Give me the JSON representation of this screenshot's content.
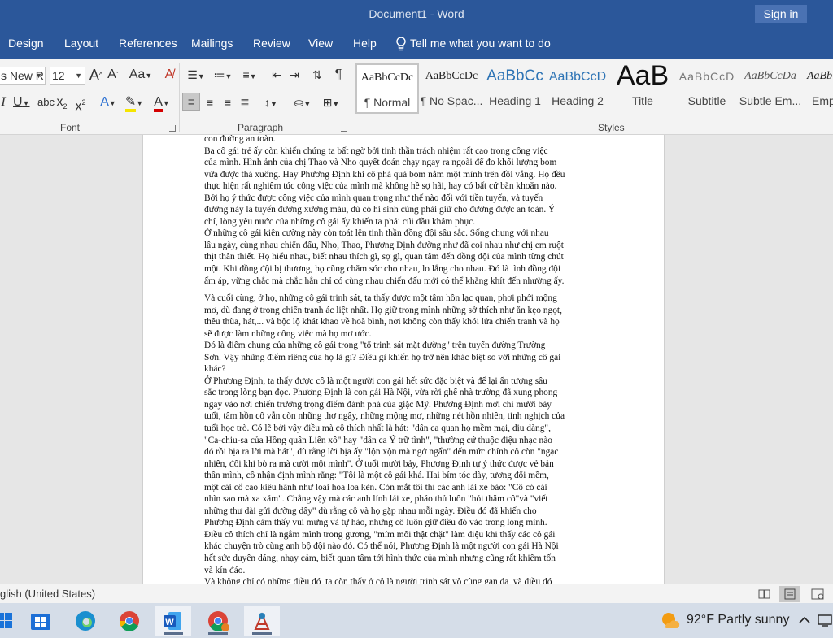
{
  "titlebar": {
    "title": "Document1  -  Word",
    "signin": "Sign in"
  },
  "tabs": [
    "Design",
    "Layout",
    "References",
    "Mailings",
    "Review",
    "View",
    "Help"
  ],
  "tellme": "Tell me what you want to do",
  "font": {
    "name": "s New R",
    "size": "12",
    "group_label": "Font"
  },
  "paragraph": {
    "group_label": "Paragraph"
  },
  "styles": {
    "group_label": "Styles",
    "items": [
      {
        "preview": "AaBbCcDc",
        "name": "¶ Normal"
      },
      {
        "preview": "AaBbCcDc",
        "name": "¶ No Spac..."
      },
      {
        "preview": "AaBbCc",
        "name": "Heading 1"
      },
      {
        "preview": "AaBbCcD",
        "name": "Heading 2"
      },
      {
        "preview": "AaB",
        "name": "Title"
      },
      {
        "preview": "AaBbCcD",
        "name": "Subtitle"
      },
      {
        "preview": "AaBbCcDa",
        "name": "Subtle Em..."
      },
      {
        "preview": "AaBb",
        "name": "Emp"
      }
    ]
  },
  "colors": {
    "accent": "#2b579a",
    "highlight": "#f5e500",
    "font_color": "#d40000"
  },
  "document": {
    "page1_lines": [
      "con đường an toàn.",
      "   Ba cô gái trẻ ấy còn khiến chúng ta bất ngờ bởi tinh thần trách nhiệm rất cao trong công việc",
      "của mình. Hình ảnh của chị Thao và Nho quyết đoán chạy ngay ra ngoài để đo khối lượng bom",
      "vừa được thả xuống. Hay Phương Định khi cô phá quả bom nằm một mình trên đồi vắng. Họ đều",
      "thực hiện rất nghiêm túc công việc của mình mà không hề sợ hãi, hay có bất cứ băn khoăn nào.",
      "Bởi họ ý thức được công việc của mình quan trọng như thế nào đối với tiền tuyến, và tuyến",
      "đường này là tuyến đường xương máu, dù có hi sinh cũng phải giữ cho đường được an toàn. Ý",
      "chí, lòng yêu nước của những cô gái ấy khiến ta phải cúi đầu khâm phục.",
      "   Ở những cô gái kiên cường này còn toát lên tinh thần đồng đội sâu sắc. Sống chung với nhau",
      "lâu ngày, cùng nhau chiến đấu, Nho, Thao, Phương Định đường như đã coi nhau như chị em ruột",
      "thịt thân thiết. Họ hiểu nhau, biết nhau thích gì, sợ gì, quan tâm đến đồng đội của mình từng chút",
      "một. Khi đồng đội bị thương, họ cũng chăm sóc cho nhau, lo lắng cho nhau. Đó là tình đồng đội",
      "ấm áp, vững chắc mà chắc hẳn chỉ có cùng nhau chiến đấu mới có thể khăng khít đến nhường ấy."
    ],
    "page2_lines": [
      "   Và cuối cùng, ở họ, những cô gái trinh sát, ta thấy được một tâm hồn lạc quan, phơi phới mộng",
      "mơ, dù đang ở trong chiến tranh ác liệt nhất. Họ giữ trong mình những sở thích như ăn kẹo ngọt,",
      "thêu thùa, hát,... và bộc lộ khát khao về hoà bình, nơi không còn thấy khói lửa chiến tranh và họ",
      "sẽ được làm những công việc mà họ mơ ước.",
      "   Đó là điểm chung của những cô gái trong \"tổ trinh sát mặt đường\" trên tuyến đường Trường",
      "Sơn. Vậy những điểm riêng của họ là gì? Điều gì khiến họ trở nên khác biệt so với những cô gái",
      "khác?",
      "   Ở Phương Định, ta thấy được cô là một người con gái hết sức đặc biệt và để lại ấn tượng sâu",
      "sắc trong lòng bạn đọc. Phương Định là con gái Hà Nội, vừa rời ghế nhà trường đã xung phong",
      "ngay vào nơi chiến trường trọng điểm đánh phá của giặc Mỹ. Phương Định mới chỉ mười bảy",
      "tuổi, tâm hồn cô vẫn còn những thơ ngây, những mộng mơ, những nét hồn nhiên, tinh nghịch của",
      "tuổi học trò. Có lẽ bởi vậy điều mà cô thích nhất là hát: \"dân ca quan họ mềm mại, dịu dàng\",",
      "\"Ca-chiu-sa của Hồng quân Liên xô\" hay \"dân ca Ý trữ tình\", \"thường cứ thuộc điệu nhạc nào",
      "đó rồi bịa ra lời mà hát\", dù rằng lời bịa ấy \"lộn xộn mà ngớ ngẩn\" đến mức chính cô còn \"ngạc",
      "nhiên, đôi khi bò ra mà cười một mình\". Ở tuổi mười bảy, Phương Định tự ý thức được vẻ bản",
      "thân mình, cô nhận định mình rằng: \"Tôi là một cô gái khá. Hai bím tóc dày, tương đối mềm,",
      "một cái cổ cao kiêu hãnh như loài hoa loa kèn. Còn mắt tôi thì các anh lái xe bảo: \"Cô có cái",
      "nhìn sao mà xa xăm\". Chẳng vậy mà các anh lính lái xe, pháo thủ luôn \"hỏi thăm cô\"và \"viết",
      "những thư dài gửi đường dây\" dù rằng cô và họ gặp nhau mỗi ngày. Điều đó đã khiến cho",
      "Phương Định cảm thấy vui mừng và tự hào, nhưng cô luôn giữ điều đó vào trong lòng mình.",
      "Điều cô thích chỉ là ngắm mình trong gương, \"mím môi thật chặt\" làm điệu khi thấy các cô gái",
      "khác chuyện trò cùng anh bộ đội nào đó. Có thể nói, Phương Định là một người con gái Hà Nội",
      "hết sức duyên dáng, nhạy cảm, biết quan tâm tới hình thức của mình nhưng cũng rất khiêm tốn",
      "và kín đáo.",
      "   Và không chỉ có những điều đó, ta còn thấy ở cô là người trinh sát vô cùng gan dạ, và điều đó"
    ]
  },
  "status": {
    "language": "glish (United States)"
  },
  "taskbar": {
    "apps": [
      "windows-start",
      "microsoft-store",
      "edge",
      "chrome",
      "word",
      "chrome-profile",
      "paint-app"
    ],
    "weather": "92°F  Partly sunny"
  }
}
